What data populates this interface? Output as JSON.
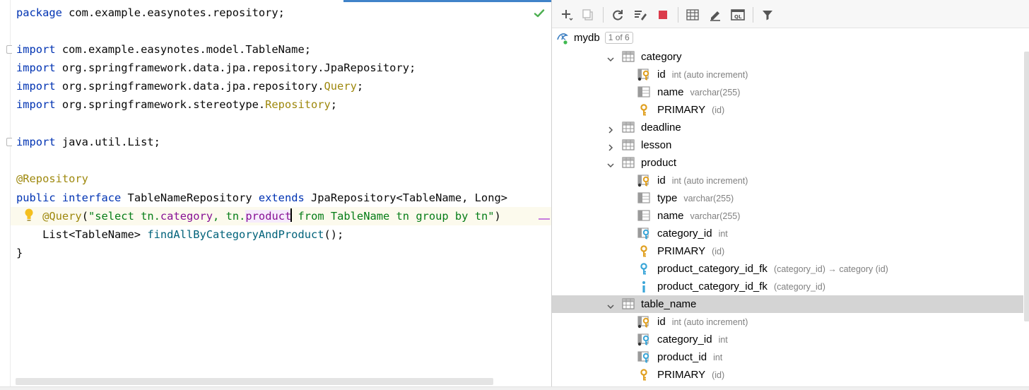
{
  "editor": {
    "package_kw": "package",
    "package_name": " com.example.easynotes.repository;",
    "imports": [
      {
        "kw": "import",
        "plain": " com.example.easynotes.model.TableName;",
        "hl": "",
        "tail": ""
      },
      {
        "kw": "import",
        "plain": " org.springframework.data.jpa.repository.JpaRepository;",
        "hl": "",
        "tail": ""
      },
      {
        "kw": "import",
        "plain": " org.springframework.data.jpa.repository.",
        "hl": "Query",
        "tail": ";"
      },
      {
        "kw": "import",
        "plain": " org.springframework.stereotype.",
        "hl": "Repository",
        "tail": ";"
      }
    ],
    "import_util": {
      "kw": "import",
      "plain": " java.util.List;"
    },
    "annotation": "@Repository",
    "decl": {
      "public_kw": "public",
      "interface_kw": " interface",
      "name": " TableNameRepository",
      "extends_kw": " extends",
      "rest": " JpaRepository<TableName, Long>"
    },
    "query_line": {
      "annotation": "@Query",
      "paren_open": "(",
      "str_a": "\"select tn.",
      "field_category": "category",
      "str_b": ", tn.",
      "field_product": "product",
      "str_c": " from TableName tn group by tn\"",
      "paren_close": ")"
    },
    "method_line": {
      "type": "    List<TableName> ",
      "name": "findAllByCategoryAndProduct",
      "tail": "();"
    },
    "closing_brace": "}"
  },
  "db_panel": {
    "toolbar_icons": [
      "add-icon",
      "duplicate-icon",
      "refresh-icon",
      "properties-icon",
      "stop-icon",
      "table-view-icon",
      "edit-icon",
      "query-console-icon",
      "filter-icon"
    ],
    "datasource": {
      "name": "mydb",
      "badge": "1 of 6"
    },
    "tables": [
      {
        "name": "category",
        "expanded": true,
        "children": [
          {
            "name": "id",
            "meta": "int (auto increment)",
            "icon": "primary-key-column-icon"
          },
          {
            "name": "name",
            "meta": "varchar(255)",
            "icon": "column-icon"
          },
          {
            "name": "PRIMARY",
            "meta": "(id)",
            "icon": "key-icon"
          }
        ]
      },
      {
        "name": "deadline",
        "expanded": false,
        "children": []
      },
      {
        "name": "lesson",
        "expanded": false,
        "children": []
      },
      {
        "name": "product",
        "expanded": true,
        "children": [
          {
            "name": "id",
            "meta": "int (auto increment)",
            "icon": "primary-key-column-icon"
          },
          {
            "name": "type",
            "meta": "varchar(255)",
            "icon": "column-icon"
          },
          {
            "name": "name",
            "meta": "varchar(255)",
            "icon": "column-icon"
          },
          {
            "name": "category_id",
            "meta": "int",
            "icon": "foreign-key-column-icon"
          },
          {
            "name": "PRIMARY",
            "meta": "(id)",
            "icon": "key-icon"
          },
          {
            "name": "product_category_id_fk",
            "meta": "(category_id) → category (id)",
            "icon": "foreign-key-icon"
          },
          {
            "name": "product_category_id_fk",
            "meta": "(category_id)",
            "icon": "index-icon"
          }
        ]
      },
      {
        "name": "table_name",
        "expanded": true,
        "selected": true,
        "children": [
          {
            "name": "id",
            "meta": "int (auto increment)",
            "icon": "primary-key-column-icon"
          },
          {
            "name": "category_id",
            "meta": "int",
            "icon": "primary-foreign-key-column-icon"
          },
          {
            "name": "product_id",
            "meta": "int",
            "icon": "foreign-key-column-icon"
          },
          {
            "name": "PRIMARY",
            "meta": "(id)",
            "icon": "key-icon"
          }
        ]
      }
    ]
  }
}
